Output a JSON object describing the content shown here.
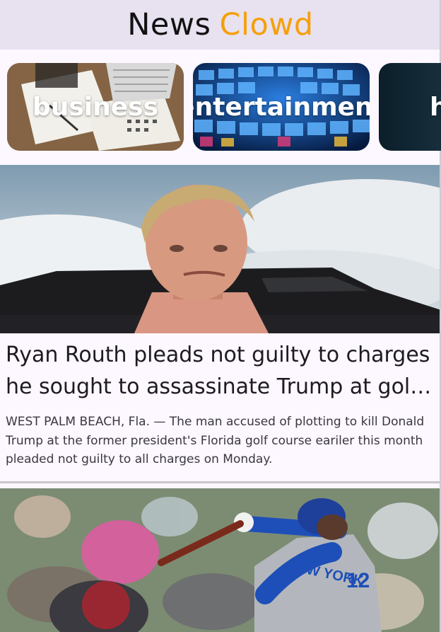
{
  "appbar": {
    "title_part1": "News",
    "title_part2": "Clowd"
  },
  "categories": [
    {
      "label": "business"
    },
    {
      "label": "entertainment"
    },
    {
      "label": "h"
    }
  ],
  "articles": [
    {
      "title": "Ryan Routh pleads not guilty to charges he sought to assassinate Trump at golf course",
      "description": "WEST PALM BEACH, Fla. — The man accused of plotting to kill Donald Trump at the former president's Florida golf course eariler this month pleaded not guilty to all charges on Monday."
    },
    {
      "jersey_text": "NEW YORK",
      "jersey_number": "12"
    }
  ],
  "colors": {
    "accent": "#f5a009",
    "appbar_bg": "#e8e1f0",
    "page_bg": "#fdf7ff"
  }
}
